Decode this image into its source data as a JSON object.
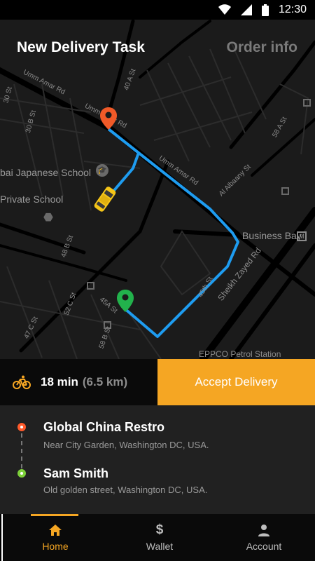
{
  "status_bar": {
    "time": "12:30"
  },
  "header": {
    "title": "New Delivery Task",
    "order_info": "Order info"
  },
  "map_labels": {
    "umm_amar_1": "Umm Amar Rd",
    "umm_amar_2": "Umm Amar Rd",
    "umm_amar_3": "Umm Amar Rd",
    "japanese_school": "bai Japanese School",
    "private_school": "Private School",
    "al_albaany": "Al Albaany St",
    "business_bay": "Business Bay",
    "sheikh_zayed": "Sheikh Zayed Rd",
    "eppco": "EPPCO Petrol Station",
    "st_45a": "45A St",
    "st_45th": "45th St",
    "st_40a": "40 A St",
    "st_30b": "30 B St",
    "st_48b": "48 B St",
    "st_52c": "52 C St",
    "st_47c": "47 C St",
    "st_58b": "58 B St",
    "st_58a": "58 A St",
    "st_30": "30 St"
  },
  "eta": {
    "minutes": "18 min",
    "distance": "(6.5 km)"
  },
  "accept_button": "Accept Delivery",
  "pickup": {
    "name": "Global China Restro",
    "address": "Near City Garden, Washington DC, USA."
  },
  "dropoff": {
    "name": "Sam Smith",
    "address": "Old golden street, Washington DC, USA."
  },
  "nav": {
    "home": "Home",
    "wallet": "Wallet",
    "account": "Account"
  },
  "colors": {
    "accent": "#f5a623",
    "route": "#1e9cf0",
    "pickup_pin": "#f05a28",
    "drop_pin": "#22b24c"
  }
}
